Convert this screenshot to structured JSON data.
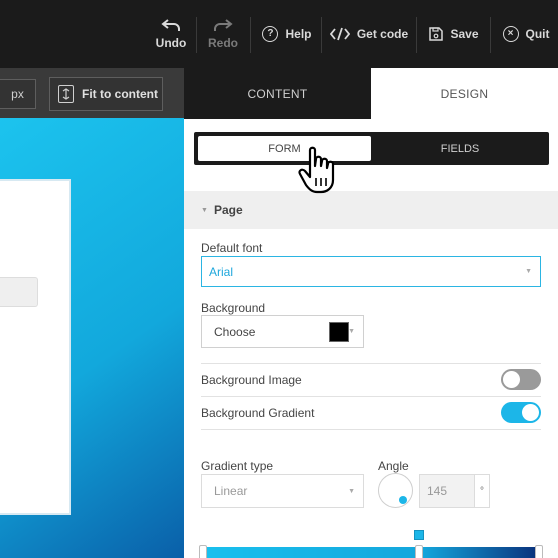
{
  "toolbar": {
    "undo": "Undo",
    "redo": "Redo",
    "help": "Help",
    "get_code": "Get code",
    "save": "Save",
    "quit": "Quit"
  },
  "subbar": {
    "unit": "px",
    "fit_to_content": "Fit to content"
  },
  "panel": {
    "tabs": [
      "CONTENT",
      "DESIGN"
    ],
    "active_tab": "DESIGN",
    "segments": [
      "FORM",
      "FIELDS"
    ],
    "active_segment": "FORM",
    "section_title": "Page",
    "default_font_label": "Default font",
    "default_font_value": "Arial",
    "background_label": "Background",
    "background_value": "Choose",
    "background_color": "#000000",
    "background_image_label": "Background Image",
    "background_image_on": false,
    "background_gradient_label": "Background Gradient",
    "background_gradient_on": true,
    "gradient_type_label": "Gradient type",
    "gradient_type_value": "Linear",
    "angle_label": "Angle",
    "angle_value": "145",
    "angle_unit": "°"
  },
  "colors": {
    "accent": "#1cb6e8",
    "toolbar_bg": "#1b1b1b",
    "canvas_gradient_start": "#1cc3ee",
    "canvas_gradient_end": "#0a5fa8"
  }
}
